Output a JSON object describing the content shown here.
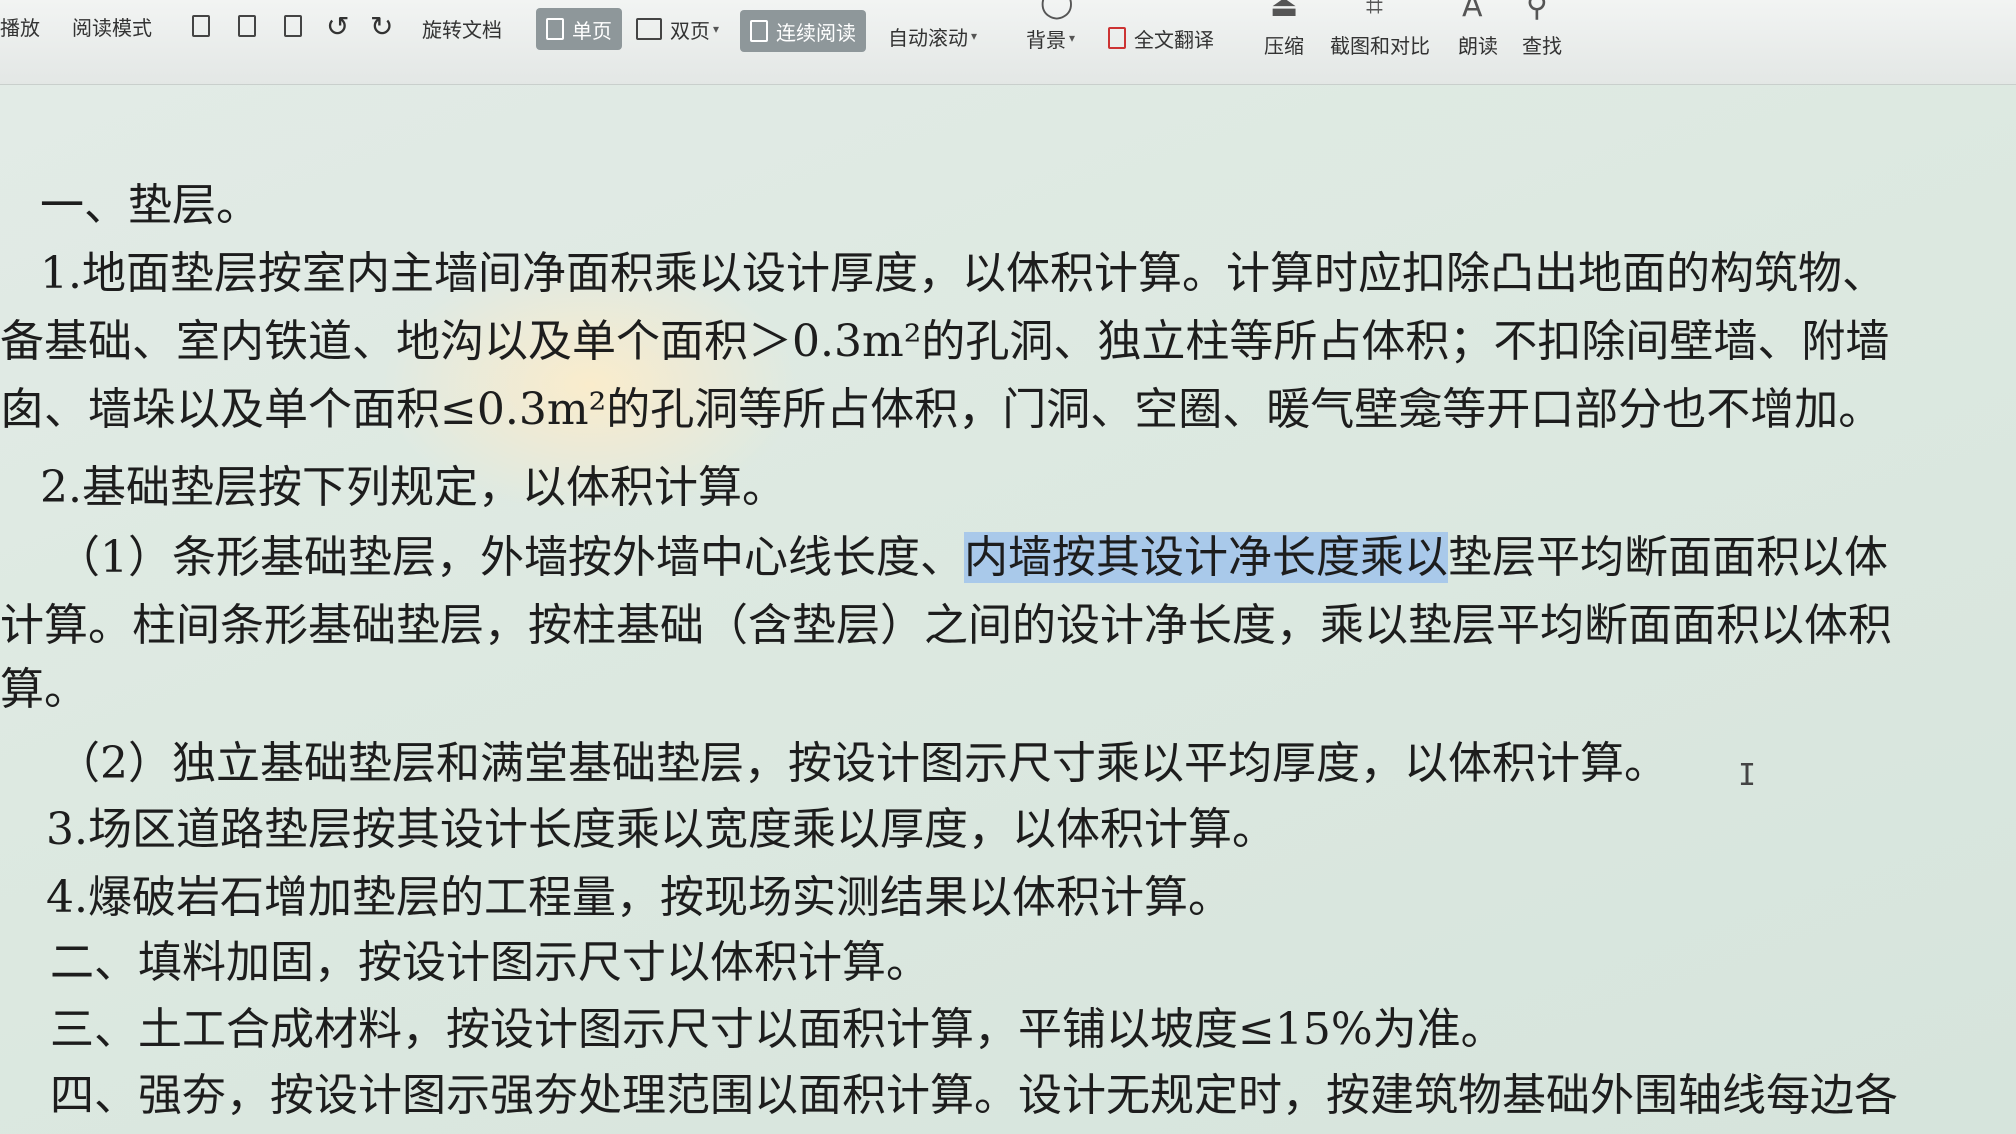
{
  "toolbar": {
    "play": "播放",
    "read_mode": "阅读模式",
    "rotate_doc": "旋转文档",
    "single_page": "单页",
    "double_page": "双页",
    "continuous": "连续阅读",
    "auto_scroll": "自动滚动",
    "background": "背景",
    "translate": "全文翻译",
    "compress": "压缩",
    "screenshot_compare": "截图和对比",
    "read_aloud": "朗读",
    "find": "查找"
  },
  "doc": {
    "l1": "一、垫层。",
    "l2": "1.地面垫层按室内主墙间净面积乘以设计厚度，以体积计算。计算时应扣除凸出地面的构筑物、",
    "l3": "备基础、室内铁道、地沟以及单个面积＞0.3m²的孔洞、独立柱等所占体积；不扣除间壁墙、附墙",
    "l4": "囱、墙垛以及单个面积≤0.3m²的孔洞等所占体积，门洞、空圈、暖气壁龛等开口部分也不增加。",
    "l5": "2.基础垫层按下列规定，以体积计算。",
    "l6a": "（1）条形基础垫层，外墙按外墙中心线长度、",
    "l6_hl": "内墙按其设计净长度乘以",
    "l6b": "垫层平均断面面积以体",
    "l7": "计算。柱间条形基础垫层，按柱基础（含垫层）之间的设计净长度，乘以垫层平均断面面积以体积",
    "l8": "算。",
    "l9": "（2）独立基础垫层和满堂基础垫层，按设计图示尺寸乘以平均厚度，以体积计算。",
    "l10": "3.场区道路垫层按其设计长度乘以宽度乘以厚度，以体积计算。",
    "l11": "4.爆破岩石增加垫层的工程量，按现场实测结果以体积计算。",
    "l12": "二、填料加固，按设计图示尺寸以体积计算。",
    "l13": "三、土工合成材料，按设计图示尺寸以面积计算，平铺以坡度≤15%为准。",
    "l14": "四、强夯，按设计图示强夯处理范围以面积计算。设计无规定时，按建筑物基础外围轴线每边各"
  },
  "colors": {
    "highlight": "#a9c9ea",
    "active_button": "#8e979a"
  }
}
